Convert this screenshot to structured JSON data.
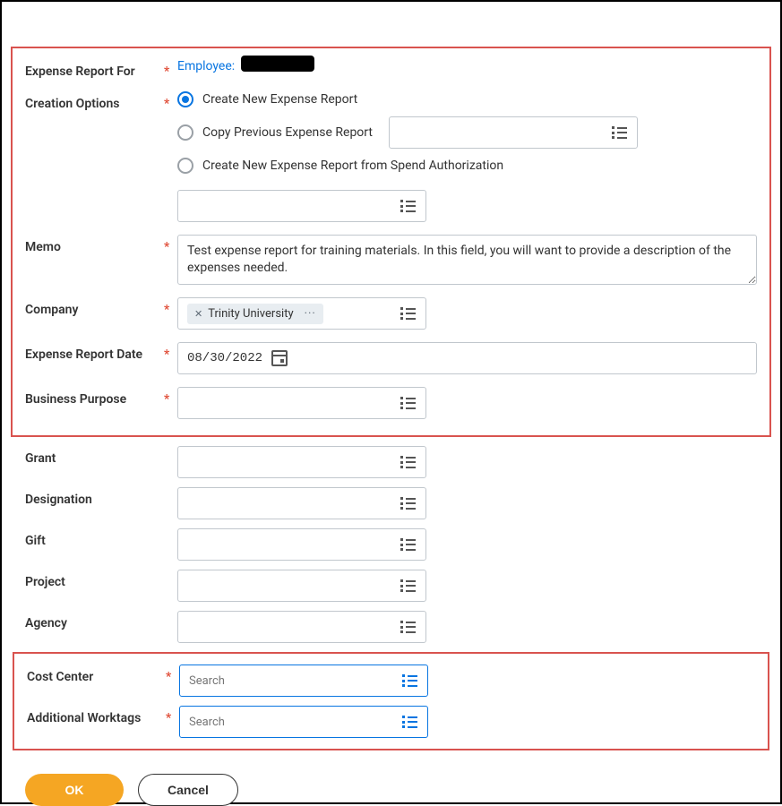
{
  "labels": {
    "expense_report_for": "Expense Report For",
    "creation_options": "Creation Options",
    "memo": "Memo",
    "company": "Company",
    "expense_report_date": "Expense Report Date",
    "business_purpose": "Business Purpose",
    "grant": "Grant",
    "designation": "Designation",
    "gift": "Gift",
    "project": "Project",
    "agency": "Agency",
    "cost_center": "Cost Center",
    "additional_worktags": "Additional Worktags"
  },
  "employee_prefix": "Employee:",
  "creation": {
    "opt1": "Create New Expense Report",
    "opt2": "Copy Previous Expense Report",
    "opt3": "Create New Expense Report from Spend Authorization"
  },
  "memo_text": "Test expense report for training materials. In this field, you will want to provide a description of the expenses needed.",
  "company_chip": "Trinity University",
  "date_value": "08/30/2022",
  "search_placeholder": "Search",
  "buttons": {
    "ok": "OK",
    "cancel": "Cancel"
  },
  "req_mark": "*"
}
